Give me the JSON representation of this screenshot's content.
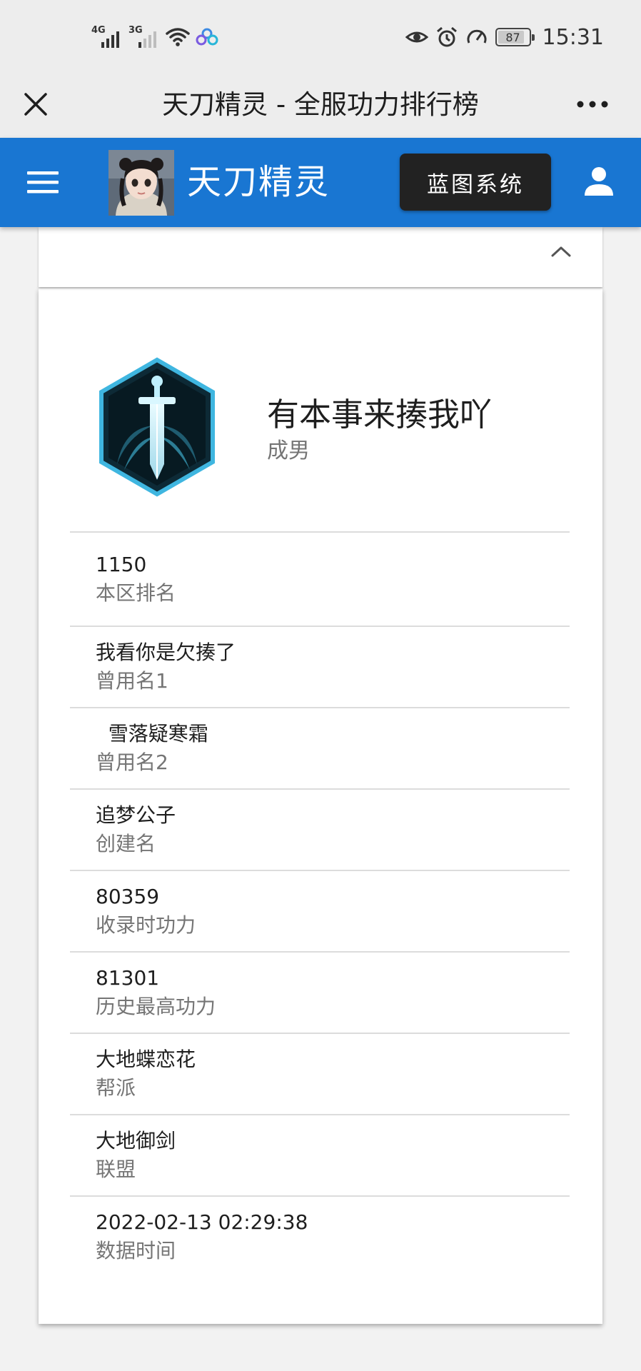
{
  "status_bar": {
    "network_1": "4G",
    "network_2": "3G",
    "battery": "87",
    "time": "15:31"
  },
  "title_bar": {
    "title": "天刀精灵 - 全服功力排行榜"
  },
  "app_header": {
    "brand": "天刀精灵",
    "blueprint_button": "蓝图系统",
    "accent_color": "#1976d2"
  },
  "profile": {
    "name": "有本事来揍我吖",
    "class": "成男",
    "emblem_icon": "sword-emblem-icon"
  },
  "info_rows": [
    {
      "value": "1150",
      "label": "本区排名"
    },
    {
      "value": "我看你是欠揍了",
      "label": "曾用名1"
    },
    {
      "value": "  雪落疑寒霜",
      "label": "曾用名2"
    },
    {
      "value": "追梦公子",
      "label": "创建名"
    },
    {
      "value": "80359",
      "label": "收录时功力"
    },
    {
      "value": "81301",
      "label": "历史最高功力"
    },
    {
      "value": "大地蝶恋花",
      "label": "帮派"
    },
    {
      "value": "大地御剑",
      "label": "联盟"
    },
    {
      "value": "2022-02-13 02:29:38",
      "label": "数据时间"
    }
  ]
}
